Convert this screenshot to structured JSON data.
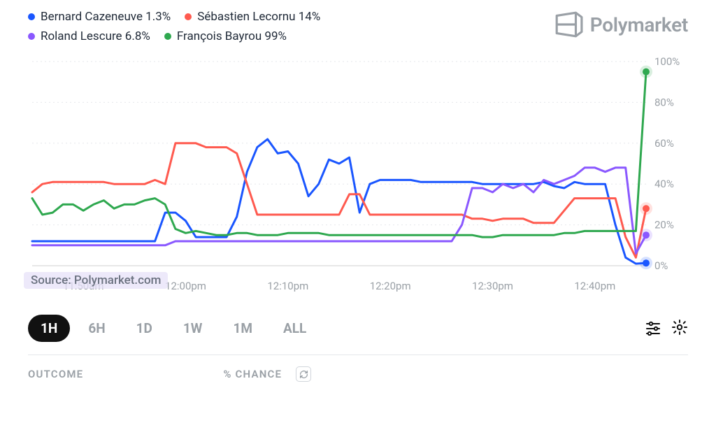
{
  "brand": {
    "name": "Polymarket"
  },
  "legend": [
    {
      "label": "Bernard Cazeneuve 1.3%",
      "color": "#1a56ff"
    },
    {
      "label": "Sébastien Lecornu 14%",
      "color": "#ff5a4f"
    },
    {
      "label": "Roland Lescure 6.8%",
      "color": "#8a58ff"
    },
    {
      "label": "François Bayrou 99%",
      "color": "#2fa84f"
    }
  ],
  "source": {
    "text": "Source: Polymarket.com"
  },
  "ranges": [
    "1H",
    "6H",
    "1D",
    "1W",
    "1M",
    "ALL"
  ],
  "active_range": "1H",
  "footer": {
    "outcome": "OUTCOME",
    "chance": "% CHANCE"
  },
  "chart_data": {
    "type": "line",
    "title": "",
    "xlabel": "",
    "ylabel": "",
    "ylim": [
      0,
      100
    ],
    "y_ticks": [
      "0%",
      "20%",
      "40%",
      "60%",
      "80%",
      "100%"
    ],
    "categories": [
      "11:50am",
      "12:00pm",
      "12:10pm",
      "12:20pm",
      "12:30pm",
      "12:40pm"
    ],
    "x": [
      0,
      1,
      2,
      3,
      4,
      5,
      6,
      7,
      8,
      9,
      10,
      11,
      12,
      13,
      14,
      15,
      16,
      17,
      18,
      19,
      20,
      21,
      22,
      23,
      24,
      25,
      26,
      27,
      28,
      29,
      30,
      31,
      32,
      33,
      34,
      35,
      36,
      37,
      38,
      39,
      40,
      41,
      42,
      43,
      44,
      45,
      46,
      47,
      48,
      49,
      50,
      51,
      52,
      53,
      54,
      55,
      56,
      57,
      58,
      59,
      60
    ],
    "series": [
      {
        "name": "Bernard Cazeneuve",
        "color": "#1a56ff",
        "marker_end": 1.3,
        "values": [
          12,
          12,
          12,
          12,
          12,
          12,
          12,
          12,
          12,
          12,
          12,
          12,
          12,
          26,
          26,
          22,
          14,
          14,
          14,
          14,
          24,
          46,
          58,
          62,
          55,
          56,
          50,
          34,
          40,
          52,
          50,
          53,
          26,
          40,
          42,
          42,
          42,
          42,
          41,
          41,
          41,
          41,
          41,
          41,
          40,
          40,
          40,
          40,
          40,
          40,
          41,
          39,
          38,
          41,
          40,
          40,
          40,
          20,
          4,
          1,
          1.3
        ]
      },
      {
        "name": "Sébastien Lecornu",
        "color": "#ff5a4f",
        "marker_end": 28,
        "values": [
          36,
          40,
          41,
          41,
          41,
          41,
          41,
          41,
          40,
          40,
          40,
          40,
          42,
          40,
          60,
          60,
          60,
          58,
          58,
          58,
          55,
          40,
          25,
          25,
          25,
          25,
          25,
          25,
          25,
          25,
          25,
          35,
          35,
          25,
          25,
          25,
          25,
          25,
          25,
          25,
          25,
          25,
          25,
          23,
          23,
          22,
          23,
          23,
          23,
          21,
          21,
          21,
          27,
          33,
          33,
          33,
          33,
          33,
          14,
          4,
          28
        ]
      },
      {
        "name": "Roland Lescure",
        "color": "#8a58ff",
        "marker_end": 15,
        "values": [
          10,
          10,
          10,
          10,
          10,
          10,
          10,
          10,
          10,
          10,
          10,
          10,
          10,
          10,
          12,
          12,
          12,
          12,
          12,
          12,
          12,
          12,
          12,
          12,
          12,
          12,
          12,
          12,
          12,
          12,
          12,
          12,
          12,
          12,
          12,
          12,
          12,
          12,
          12,
          12,
          12,
          12,
          20,
          38,
          38,
          36,
          40,
          38,
          40,
          36,
          42,
          40,
          42,
          44,
          48,
          48,
          46,
          48,
          48,
          6,
          15
        ]
      },
      {
        "name": "François Bayrou",
        "color": "#2fa84f",
        "marker_end": 95,
        "values": [
          33,
          25,
          26,
          30,
          30,
          27,
          30,
          32,
          28,
          30,
          30,
          32,
          33,
          30,
          18,
          16,
          17,
          16,
          15,
          15,
          16,
          16,
          15,
          15,
          15,
          16,
          16,
          16,
          16,
          15,
          15,
          15,
          15,
          15,
          15,
          15,
          15,
          15,
          15,
          15,
          15,
          15,
          15,
          15,
          14,
          14,
          15,
          15,
          15,
          15,
          15,
          15,
          16,
          16,
          17,
          17,
          17,
          17,
          17,
          17,
          95
        ]
      }
    ]
  }
}
